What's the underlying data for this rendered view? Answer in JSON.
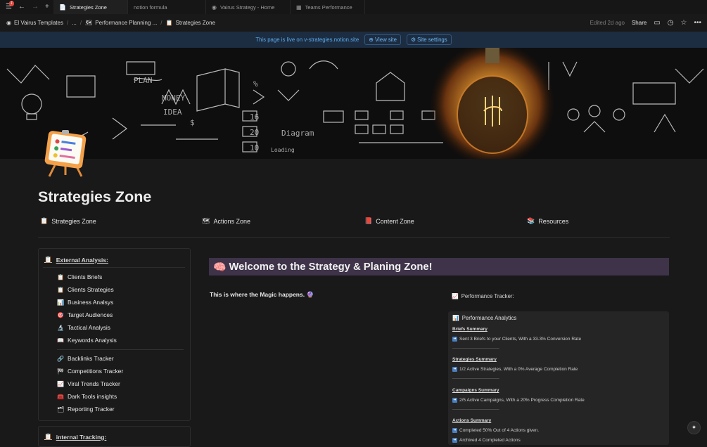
{
  "tabs": [
    {
      "label": "Strategies Zone",
      "icon": "📄"
    },
    {
      "label": "notion formula",
      "icon": ""
    },
    {
      "label": "Vairus Strategy - Home",
      "icon": "◉"
    },
    {
      "label": "Teams Performance",
      "icon": "▦"
    }
  ],
  "badge_count": "1",
  "breadcrumb": [
    "El Vairus Templates",
    "...",
    "Performance Planning ...",
    "Strategies Zone"
  ],
  "topbar": {
    "edited": "Edited 2d ago",
    "share": "Share"
  },
  "livebar": {
    "text": "This page is live on v-strategies.notion.site",
    "view_site": "View site",
    "site_settings": "Site settings"
  },
  "page_title": "Strategies Zone",
  "zones": [
    {
      "label": "Strategies Zone",
      "icon": "📋"
    },
    {
      "label": "Actions Zone",
      "icon": "🗺"
    },
    {
      "label": "Content Zone",
      "icon": "📕"
    },
    {
      "label": "Resources",
      "icon": "📚"
    }
  ],
  "external": {
    "header": "External Analysis:",
    "group1": [
      {
        "label": "Clients Briefs",
        "icon": "📋"
      },
      {
        "label": "Clients Strategies",
        "icon": "📋"
      },
      {
        "label": "Business Analsys",
        "icon": "📊"
      },
      {
        "label": "Target Audiences",
        "icon": "🎯"
      },
      {
        "label": "Tactical Analysis",
        "icon": "🔬"
      },
      {
        "label": "Keywords Analysis",
        "icon": "📖"
      }
    ],
    "group2": [
      {
        "label": "Backlinks Tracker",
        "icon": "🔗"
      },
      {
        "label": "Competitions Tracker",
        "icon": "🏁"
      },
      {
        "label": "Viral Trends Tracker",
        "icon": "📈"
      },
      {
        "label": "Dark Tools insights",
        "icon": "🧰"
      },
      {
        "label": "Reporting Tracker",
        "icon": "🗂"
      }
    ]
  },
  "internal_header": "internal Tracking:",
  "welcome": "Welcome to the Strategy & Planing Zone!",
  "magic": "This is where the Magic happens.",
  "tracker": {
    "header": "Performance Tracker:",
    "title": "Performance Analytics",
    "summaries": [
      {
        "h": "Briefs Summary",
        "t": "Sent 3 Briefs to your Clients, With a 33.3% Conversion Rate"
      },
      {
        "h": "Strategies Summary",
        "t": "1/2 Active Strategies, With a 0% Average Completion Rate"
      },
      {
        "h": "Campaigns Summary",
        "t": "2/5 Active Campaigns, With a 20% Progress Completion Rate"
      },
      {
        "h": "Actions Summary",
        "t": "Completed 50% Out of 4 Actions given.",
        "t2": "Archived 4 Completed Actions"
      }
    ],
    "divider": "————————————"
  }
}
